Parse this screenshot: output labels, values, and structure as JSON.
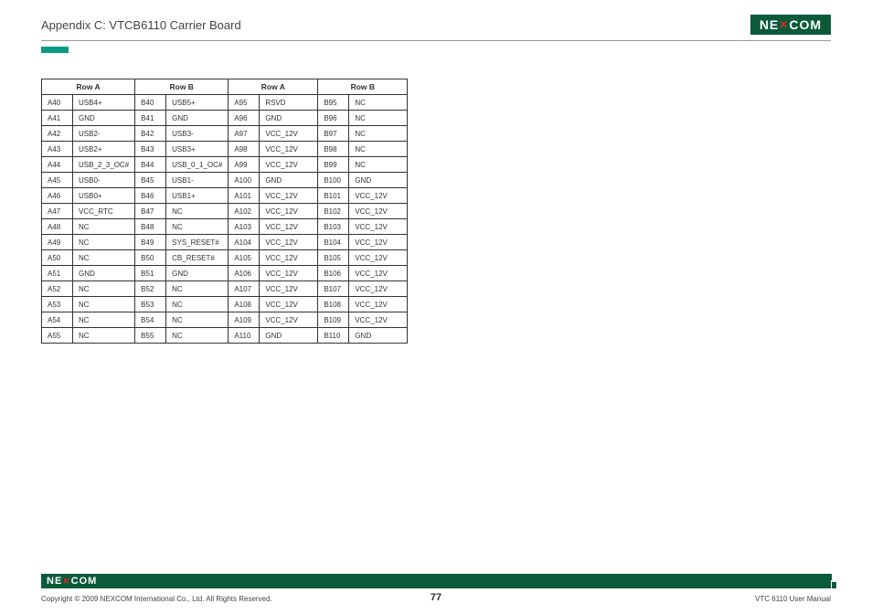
{
  "header": {
    "title": "Appendix C: VTCB6110 Carrier Board",
    "brand_parts": [
      "NE",
      "COM"
    ]
  },
  "table": {
    "headers": [
      "Row A",
      "Row B",
      "Row A",
      "Row B"
    ],
    "rows": [
      {
        "a_pin": "A40",
        "a_sig": "USB4+",
        "b_pin": "B40",
        "b_sig": "USB5+",
        "c_pin": "A95",
        "c_sig": "RSVD",
        "d_pin": "B95",
        "d_sig": "NC"
      },
      {
        "a_pin": "A41",
        "a_sig": "GND",
        "b_pin": "B41",
        "b_sig": "GND",
        "c_pin": "A96",
        "c_sig": "GND",
        "d_pin": "B96",
        "d_sig": "NC"
      },
      {
        "a_pin": "A42",
        "a_sig": "USB2-",
        "b_pin": "B42",
        "b_sig": "USB3-",
        "c_pin": "A97",
        "c_sig": "VCC_12V",
        "d_pin": "B97",
        "d_sig": "NC"
      },
      {
        "a_pin": "A43",
        "a_sig": "USB2+",
        "b_pin": "B43",
        "b_sig": "USB3+",
        "c_pin": "A98",
        "c_sig": "VCC_12V",
        "d_pin": "B98",
        "d_sig": "NC"
      },
      {
        "a_pin": "A44",
        "a_sig": "USB_2_3_OC#",
        "b_pin": "B44",
        "b_sig": "USB_0_1_OC#",
        "c_pin": "A99",
        "c_sig": "VCC_12V",
        "d_pin": "B99",
        "d_sig": "NC"
      },
      {
        "a_pin": "A45",
        "a_sig": "USB0-",
        "b_pin": "B45",
        "b_sig": "USB1-",
        "c_pin": "A100",
        "c_sig": "GND",
        "d_pin": "B100",
        "d_sig": "GND"
      },
      {
        "a_pin": "A46",
        "a_sig": "USB0+",
        "b_pin": "B46",
        "b_sig": "USB1+",
        "c_pin": "A101",
        "c_sig": "VCC_12V",
        "d_pin": "B101",
        "d_sig": "VCC_12V"
      },
      {
        "a_pin": "A47",
        "a_sig": "VCC_RTC",
        "b_pin": "B47",
        "b_sig": "NC",
        "c_pin": "A102",
        "c_sig": "VCC_12V",
        "d_pin": "B102",
        "d_sig": "VCC_12V"
      },
      {
        "a_pin": "A48",
        "a_sig": "NC",
        "b_pin": "B48",
        "b_sig": "NC",
        "c_pin": "A103",
        "c_sig": "VCC_12V",
        "d_pin": "B103",
        "d_sig": "VCC_12V"
      },
      {
        "a_pin": "A49",
        "a_sig": "NC",
        "b_pin": "B49",
        "b_sig": "SYS_RESET#",
        "c_pin": "A104",
        "c_sig": "VCC_12V",
        "d_pin": "B104",
        "d_sig": "VCC_12V"
      },
      {
        "a_pin": "A50",
        "a_sig": "NC",
        "b_pin": "B50",
        "b_sig": "CB_RESET#",
        "c_pin": "A105",
        "c_sig": "VCC_12V",
        "d_pin": "B105",
        "d_sig": "VCC_12V"
      },
      {
        "a_pin": "A51",
        "a_sig": "GND",
        "b_pin": "B51",
        "b_sig": "GND",
        "c_pin": "A106",
        "c_sig": "VCC_12V",
        "d_pin": "B106",
        "d_sig": "VCC_12V"
      },
      {
        "a_pin": "A52",
        "a_sig": "NC",
        "b_pin": "B52",
        "b_sig": "NC",
        "c_pin": "A107",
        "c_sig": "VCC_12V",
        "d_pin": "B107",
        "d_sig": "VCC_12V"
      },
      {
        "a_pin": "A53",
        "a_sig": "NC",
        "b_pin": "B53",
        "b_sig": "NC",
        "c_pin": "A108",
        "c_sig": "VCC_12V",
        "d_pin": "B108",
        "d_sig": "VCC_12V"
      },
      {
        "a_pin": "A54",
        "a_sig": "NC",
        "b_pin": "B54",
        "b_sig": "NC",
        "c_pin": "A109",
        "c_sig": "VCC_12V",
        "d_pin": "B109",
        "d_sig": "VCC_12V"
      },
      {
        "a_pin": "A55",
        "a_sig": "NC",
        "b_pin": "B55",
        "b_sig": "NC",
        "c_pin": "A110",
        "c_sig": "GND",
        "d_pin": "B110",
        "d_sig": "GND"
      }
    ]
  },
  "footer": {
    "copyright": "Copyright © 2009 NEXCOM International Co., Ltd. All Rights Reserved.",
    "page": "77",
    "manual": "VTC 6110 User Manual",
    "brand_parts": [
      "NE",
      "COM"
    ]
  }
}
